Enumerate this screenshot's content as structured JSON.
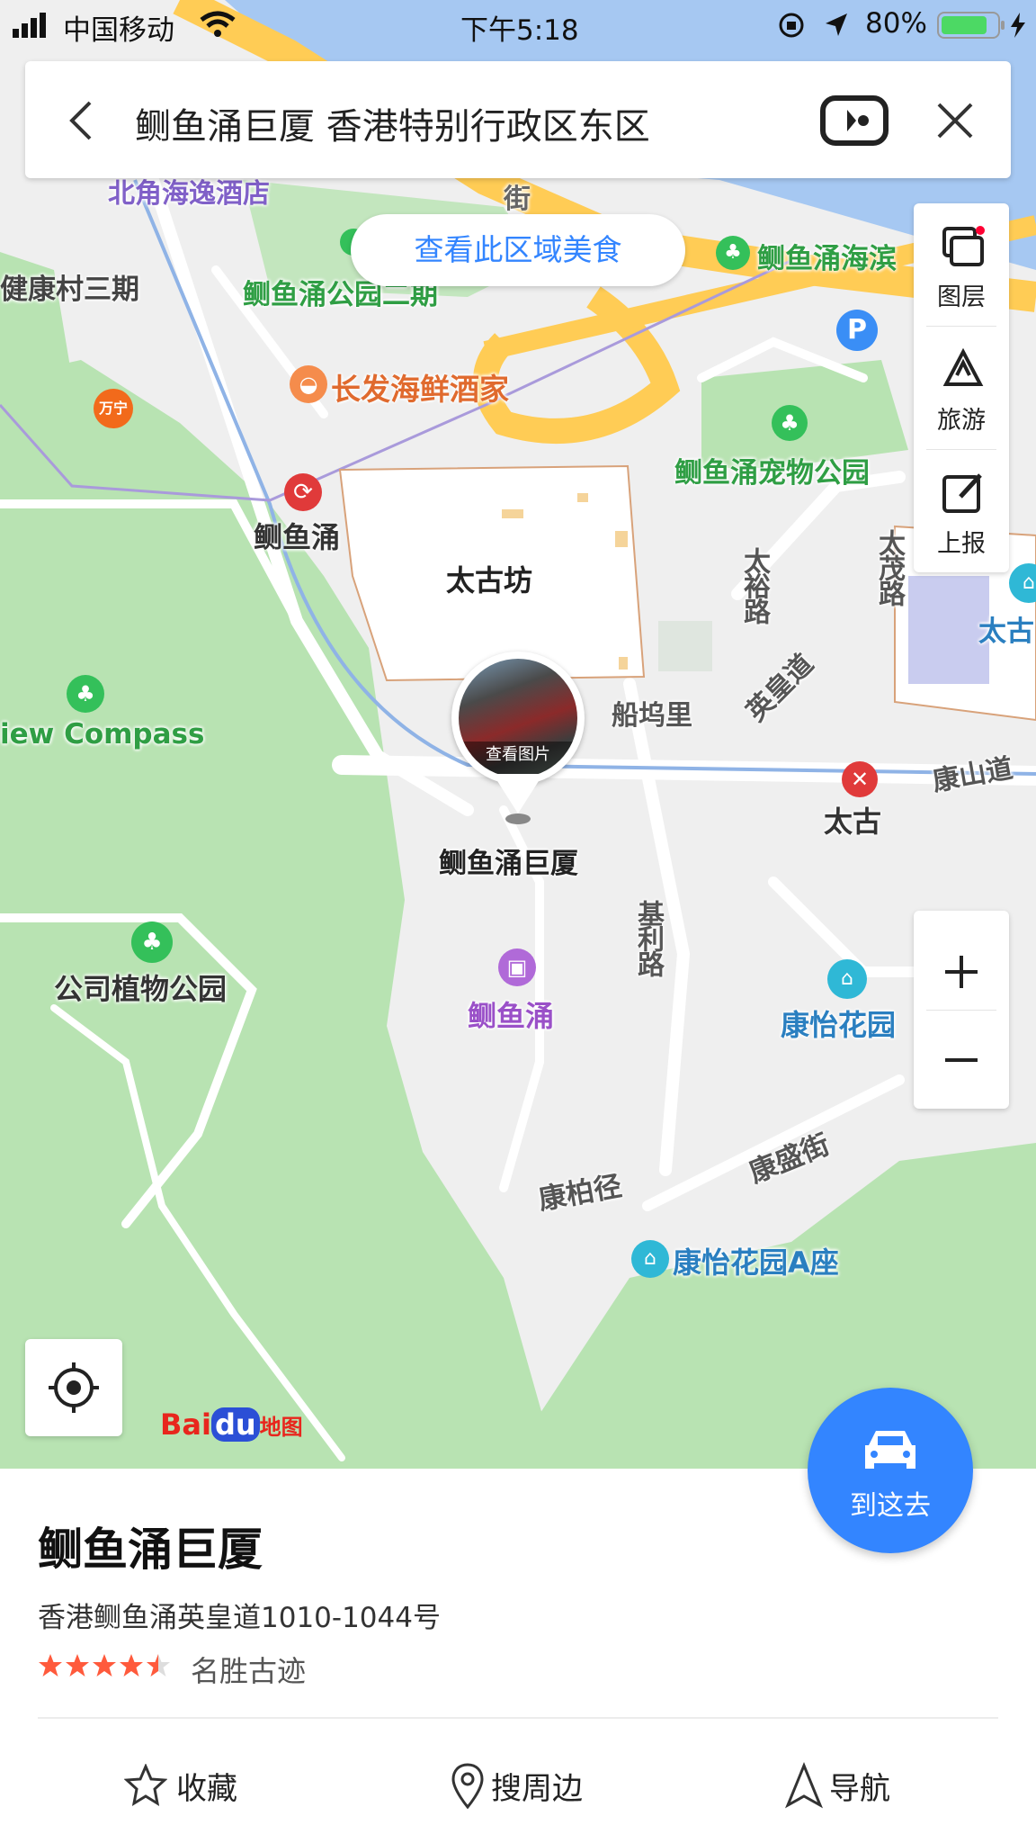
{
  "status_bar": {
    "carrier": "中国移动",
    "time": "下午5:18",
    "battery": "80%"
  },
  "search": {
    "query": "鲗鱼涌巨厦 香港特别行政区东区"
  },
  "food_button": "查看此区域美食",
  "tools": [
    {
      "label": "图层",
      "icon": "layers-icon"
    },
    {
      "label": "旅游",
      "icon": "travel-icon"
    },
    {
      "label": "上报",
      "icon": "report-icon"
    }
  ],
  "map": {
    "labels": {
      "hotel": "北角海逸酒店",
      "street_top": "街",
      "kai_hong": "健康村三期",
      "park_phase2": "鲗鱼涌公园二期",
      "seafront": "鲗鱼涌海滨",
      "seafood": "长发海鲜酒家",
      "pet_park": "鲗鱼涌宠物公园",
      "station_quarry": "鲗鱼涌",
      "taikoo_place": "太古坊",
      "tai_yue": "太裕路",
      "tai_mou": "太茂路",
      "tai_right": "太古",
      "view_compass": "iew Compass",
      "shipyard": "船坞里",
      "kings_road": "英皇道",
      "kang_shan": "康山道",
      "taikoo_station": "太古",
      "poi_name": "鲗鱼涌巨厦",
      "kornhill_road": "基利路",
      "company_park": "公司植物公园",
      "quarry_mall": "鲗鱼涌",
      "hong_yue": "康怡花园",
      "hong_pak": "康柏径",
      "hong_shing": "康盛街",
      "hong_yue_a": "康怡花园A座",
      "view_photo": "查看图片"
    },
    "logo": {
      "bai": "Bai",
      "du": "du",
      "map": "地图"
    }
  },
  "go_button": {
    "label": "到这去",
    "icon": "car-icon"
  },
  "place": {
    "name": "鲗鱼涌巨厦",
    "address": "香港鲗鱼涌英皇道1010-1044号",
    "rating": 4.5,
    "category": "名胜古迹"
  },
  "actions": [
    {
      "label": "收藏",
      "icon": "star-icon"
    },
    {
      "label": "搜周边",
      "icon": "location-pin-icon"
    },
    {
      "label": "导航",
      "icon": "navigate-icon"
    }
  ],
  "colors": {
    "accent": "#3385ff",
    "star": "#ff5a3c",
    "park": "#b8e3b2",
    "water": "#a6c8f2",
    "highway": "#ffcc55"
  }
}
